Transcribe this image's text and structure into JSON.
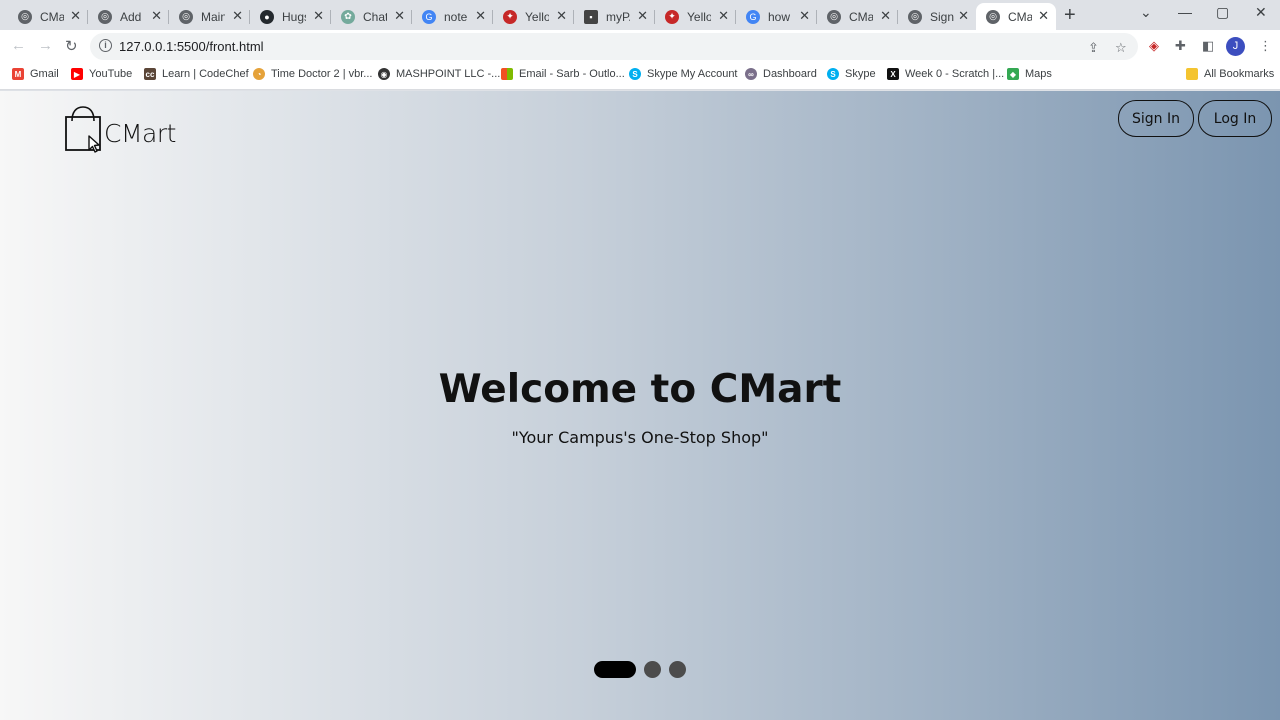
{
  "browser": {
    "tabs": [
      {
        "title": "CMar",
        "icon": "globe-icon",
        "color": "#5f6368"
      },
      {
        "title": "Add I",
        "icon": "globe-icon",
        "color": "#5f6368"
      },
      {
        "title": "Main",
        "icon": "globe-icon",
        "color": "#5f6368"
      },
      {
        "title": "Hugs",
        "icon": "github-icon",
        "color": "#24292e"
      },
      {
        "title": "ChatG",
        "icon": "chatgpt-icon",
        "color": "#74aa9c"
      },
      {
        "title": "notel",
        "icon": "google-icon",
        "color": "#4285f4"
      },
      {
        "title": "Yello",
        "icon": "yellow-logo-icon",
        "color": "#c62828"
      },
      {
        "title": "myPA",
        "icon": "mypa-icon",
        "color": "#444444"
      },
      {
        "title": "Yello",
        "icon": "yellow-logo-icon",
        "color": "#c62828"
      },
      {
        "title": "how t",
        "icon": "google-icon",
        "color": "#4285f4"
      },
      {
        "title": "CMar",
        "icon": "globe-icon",
        "color": "#5f6368"
      },
      {
        "title": "SignU",
        "icon": "globe-icon",
        "color": "#5f6368"
      },
      {
        "title": "CMar",
        "icon": "globe-icon",
        "color": "#5f6368",
        "active": true
      }
    ],
    "new_tab_label": "+",
    "url": "127.0.0.1:5500/front.html",
    "profile_initial": "J",
    "bookmarks": [
      {
        "label": "Gmail",
        "icon": "gmail-icon",
        "color": "#ea4335"
      },
      {
        "label": "YouTube",
        "icon": "youtube-icon",
        "color": "#ff0000"
      },
      {
        "label": "Learn | CodeChef",
        "icon": "codechef-icon",
        "color": "#5b4638"
      },
      {
        "label": "Time Doctor 2 | vbr...",
        "icon": "time-doctor-icon",
        "color": "#e5a23a"
      },
      {
        "label": "MASHPOINT LLC -...",
        "icon": "mashpoint-icon",
        "color": "#333333"
      },
      {
        "label": "Email - Sarb - Outlo...",
        "icon": "microsoft-icon",
        "color": "#f25022"
      },
      {
        "label": "Skype My Account",
        "icon": "skype-icon",
        "color": "#00aff0"
      },
      {
        "label": "Dashboard",
        "icon": "dashboard-icon",
        "color": "#7a6f8a"
      },
      {
        "label": "Skype",
        "icon": "skype-icon",
        "color": "#00aff0"
      },
      {
        "label": "Week 0 - Scratch |...",
        "icon": "edx-icon",
        "color": "#111111"
      },
      {
        "label": "Maps",
        "icon": "maps-icon",
        "color": "#34a853"
      }
    ],
    "all_bookmarks_label": "All Bookmarks"
  },
  "page": {
    "logo_text": "CMart",
    "sign_in_label": "Sign In",
    "log_in_label": "Log In",
    "hero_title": "Welcome to CMart",
    "hero_subtitle": "\"Your Campus's One-Stop Shop\"",
    "carousel": {
      "count": 3,
      "active_index": 0
    }
  }
}
